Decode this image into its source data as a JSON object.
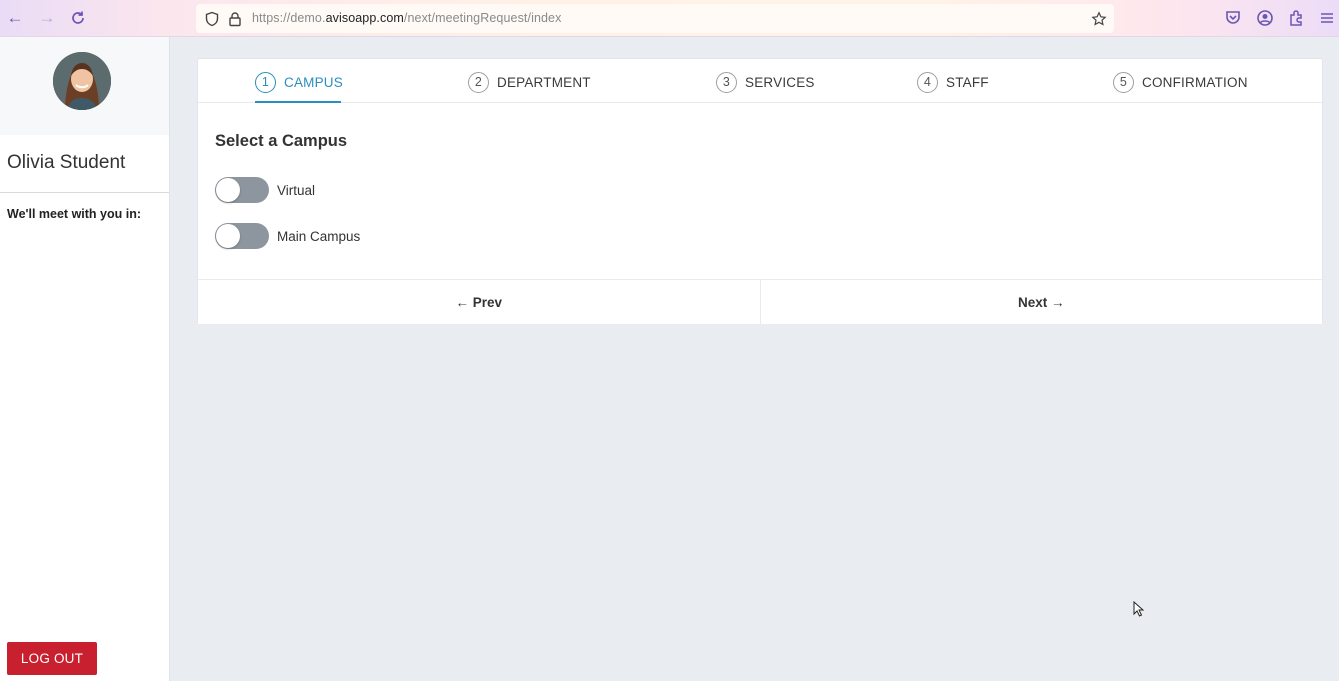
{
  "browser": {
    "url_prefix": "https://demo.",
    "url_domain": "avisoapp.com",
    "url_path": "/next/meetingRequest/index"
  },
  "sidebar": {
    "user_name": "Olivia Student",
    "meet_label": "We'll meet with you in:",
    "logout_label": "LOG OUT"
  },
  "steps": [
    {
      "num": "1",
      "label": "CAMPUS"
    },
    {
      "num": "2",
      "label": "DEPARTMENT"
    },
    {
      "num": "3",
      "label": "SERVICES"
    },
    {
      "num": "4",
      "label": "STAFF"
    },
    {
      "num": "5",
      "label": "CONFIRMATION"
    }
  ],
  "main": {
    "title": "Select a Campus",
    "options": [
      {
        "label": "Virtual",
        "on": false
      },
      {
        "label": "Main Campus",
        "on": false
      }
    ],
    "prev_label": "← Prev",
    "next_label": "Next →"
  },
  "colors": {
    "accent": "#2a8ec0",
    "logout": "#c8202f",
    "toggle_off": "#8d969f"
  }
}
